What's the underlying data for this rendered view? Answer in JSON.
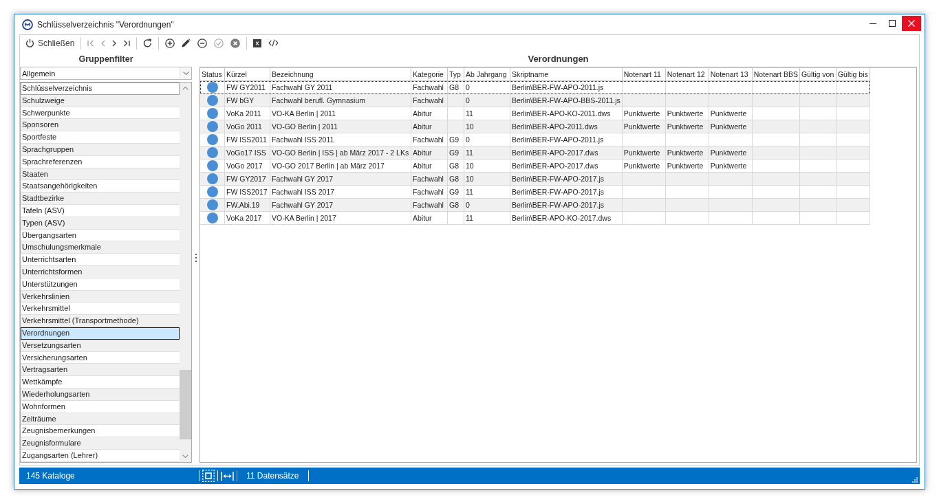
{
  "window": {
    "title": "Schlüsselverzeichnis \"Verordnungen\""
  },
  "toolbar": [
    {
      "buttons": [
        {
          "kind": "close",
          "label": "Schließen",
          "disabled": false
        }
      ]
    },
    {
      "buttons": [
        {
          "kind": "first",
          "disabled": true
        },
        {
          "kind": "previous",
          "disabled": true
        },
        {
          "kind": "next",
          "disabled": false
        },
        {
          "kind": "last",
          "disabled": false
        }
      ]
    },
    {
      "buttons": [
        {
          "kind": "refresh",
          "disabled": false
        }
      ]
    },
    {
      "buttons": [
        {
          "kind": "add",
          "disabled": false
        },
        {
          "kind": "edit",
          "disabled": false
        },
        {
          "kind": "remove",
          "disabled": false
        },
        {
          "kind": "save",
          "disabled": true
        },
        {
          "kind": "cancel",
          "disabled": true
        }
      ]
    },
    {
      "buttons": [
        {
          "kind": "excel",
          "disabled": false
        },
        {
          "kind": "code",
          "disabled": false
        }
      ]
    }
  ],
  "filter_panel": {
    "title": "Gruppenfilter",
    "dropdown": {
      "value": "Allgemein"
    },
    "items": [
      {
        "label": "Schlüsselverzeichnis",
        "selected": false,
        "focused": true
      },
      {
        "label": "Schulzweige",
        "selected": false,
        "focused": false
      },
      {
        "label": "Schwerpunkte",
        "selected": false,
        "focused": false
      },
      {
        "label": "Sponsoren",
        "selected": false,
        "focused": false
      },
      {
        "label": "Sportfeste",
        "selected": false,
        "focused": false
      },
      {
        "label": "Sprachgruppen",
        "selected": false,
        "focused": false
      },
      {
        "label": "Sprachreferenzen",
        "selected": false,
        "focused": false
      },
      {
        "label": "Staaten",
        "selected": false,
        "focused": false
      },
      {
        "label": "Staatsangehörigkeiten",
        "selected": false,
        "focused": false
      },
      {
        "label": "Stadtbezirke",
        "selected": false,
        "focused": false
      },
      {
        "label": "Tafeln (ASV)",
        "selected": false,
        "focused": false
      },
      {
        "label": "Typen (ASV)",
        "selected": false,
        "focused": false
      },
      {
        "label": "Übergangsarten",
        "selected": false,
        "focused": false
      },
      {
        "label": "Umschulungsmerkmale",
        "selected": false,
        "focused": false
      },
      {
        "label": "Unterrichtsarten",
        "selected": false,
        "focused": false
      },
      {
        "label": "Unterrichtsformen",
        "selected": false,
        "focused": false
      },
      {
        "label": "Unterstützungen",
        "selected": false,
        "focused": false
      },
      {
        "label": "Verkehrslinien",
        "selected": false,
        "focused": false
      },
      {
        "label": "Verkehrsmittel",
        "selected": false,
        "focused": false
      },
      {
        "label": "Verkehrsmittel (Transportmethode)",
        "selected": false,
        "focused": false
      },
      {
        "label": "Verordnungen",
        "selected": true,
        "focused": false
      },
      {
        "label": "Versetzungsarten",
        "selected": false,
        "focused": false
      },
      {
        "label": "Versicherungsarten",
        "selected": false,
        "focused": false
      },
      {
        "label": "Vertragsarten",
        "selected": false,
        "focused": false
      },
      {
        "label": "Wettkämpfe",
        "selected": false,
        "focused": false
      },
      {
        "label": "Wiederholungsarten",
        "selected": false,
        "focused": false
      },
      {
        "label": "Wohnformen",
        "selected": false,
        "focused": false
      },
      {
        "label": "Zeiträume",
        "selected": false,
        "focused": false
      },
      {
        "label": "Zeugnisbemerkungen",
        "selected": false,
        "focused": false
      },
      {
        "label": "Zeugnisformulare",
        "selected": false,
        "focused": false
      },
      {
        "label": "Zugangsarten (Lehrer)",
        "selected": false,
        "focused": false
      }
    ]
  },
  "grid_panel": {
    "title": "Verordnungen",
    "columns": [
      "Status",
      "Kürzel",
      "Bezeichnung",
      "Kategorie",
      "Typ",
      "Ab Jahrgang",
      "Skriptname",
      "Notenart 11",
      "Notenart 12",
      "Notenart 13",
      "Notenart BBS",
      "Gültig von",
      "Gültig bis"
    ],
    "rows": [
      {
        "color": "#4a8fd5",
        "focused": true,
        "kuerzel": "FW GY2011",
        "bezeichnung": "Fachwahl GY 2011",
        "kategorie": "Fachwahl",
        "typ": "G8",
        "ab_jahrgang": "0",
        "skriptname": "Berlin\\BER-FW-APO-2011.js"
      },
      {
        "color": "#4a8fd5",
        "focused": false,
        "kuerzel": "FW bGY",
        "bezeichnung": "Fachwahl berufl. Gymnasium",
        "kategorie": "Fachwahl",
        "ab_jahrgang": "0",
        "skriptname": "Berlin\\BER-FW-APO-BBS-2011.js"
      },
      {
        "color": "#4a8fd5",
        "focused": false,
        "kuerzel": "VoKa 2011",
        "bezeichnung": "VO-KA Berlin | 2011",
        "kategorie": "Abitur",
        "ab_jahrgang": "11",
        "skriptname": "Berlin\\BER-APO-KO-2011.dws",
        "notenart_11": "Punktwerte",
        "notenart_12": "Punktwerte",
        "notenart_13": "Punktwerte"
      },
      {
        "color": "#4a8fd5",
        "focused": false,
        "kuerzel": "VoGo 2011",
        "bezeichnung": "VO-GO Berlin | 2011",
        "kategorie": "Abitur",
        "ab_jahrgang": "10",
        "skriptname": "Berlin\\BER-APO-2011.dws",
        "notenart_11": "Punktwerte",
        "notenart_12": "Punktwerte",
        "notenart_13": "Punktwerte"
      },
      {
        "color": "#4a8fd5",
        "focused": false,
        "kuerzel": "FW ISS2011",
        "bezeichnung": "Fachwahl ISS 2011",
        "kategorie": "Fachwahl",
        "typ": "G9",
        "ab_jahrgang": "0",
        "skriptname": "Berlin\\BER-FW-APO-2011.js"
      },
      {
        "color": "#4a8fd5",
        "focused": false,
        "kuerzel": "VoGo17 ISS",
        "bezeichnung": "VO-GO Berlin | ISS | ab März 2017 - 2 LKs",
        "kategorie": "Abitur",
        "typ": "G9",
        "ab_jahrgang": "11",
        "skriptname": "Berlin\\BER-APO-2017.dws",
        "notenart_11": "Punktwerte",
        "notenart_12": "Punktwerte",
        "notenart_13": "Punktwerte"
      },
      {
        "color": "#4a8fd5",
        "focused": false,
        "kuerzel": "VoGo 2017",
        "bezeichnung": "VO-GO 2017 Berlin | ab März 2017",
        "kategorie": "Abitur",
        "typ": "G8",
        "ab_jahrgang": "10",
        "skriptname": "Berlin\\BER-APO-2017.dws",
        "notenart_11": "Punktwerte",
        "notenart_12": "Punktwerte",
        "notenart_13": "Punktwerte"
      },
      {
        "color": "#4a8fd5",
        "focused": false,
        "kuerzel": "FW GY2017",
        "bezeichnung": "Fachwahl GY 2017",
        "kategorie": "Fachwahl",
        "typ": "G8",
        "ab_jahrgang": "10",
        "skriptname": "Berlin\\BER-FW-APO-2017.js"
      },
      {
        "color": "#4a8fd5",
        "focused": false,
        "kuerzel": "FW ISS2017",
        "bezeichnung": "Fachwahl ISS 2017",
        "kategorie": "Fachwahl",
        "typ": "G9",
        "ab_jahrgang": "11",
        "skriptname": "Berlin\\BER-FW-APO-2017.js"
      },
      {
        "color": "#4a8fd5",
        "focused": false,
        "kuerzel": "FW.Abi.19",
        "bezeichnung": "Fachwahl GY 2017",
        "kategorie": "Fachwahl",
        "typ": "G8",
        "ab_jahrgang": "0",
        "skriptname": "Berlin\\BER-FW-APO-2017.js"
      },
      {
        "color": "#4a8fd5",
        "focused": false,
        "kuerzel": "VoKa 2017",
        "bezeichnung": "VO-KA Berlin | 2017",
        "kategorie": "Abitur",
        "ab_jahrgang": "11",
        "skriptname": "Berlin\\BER-APO-KO-2017.dws"
      }
    ]
  },
  "status_bar": {
    "catalog_count": "145 Kataloge",
    "record_count": "11 Datensätze"
  }
}
